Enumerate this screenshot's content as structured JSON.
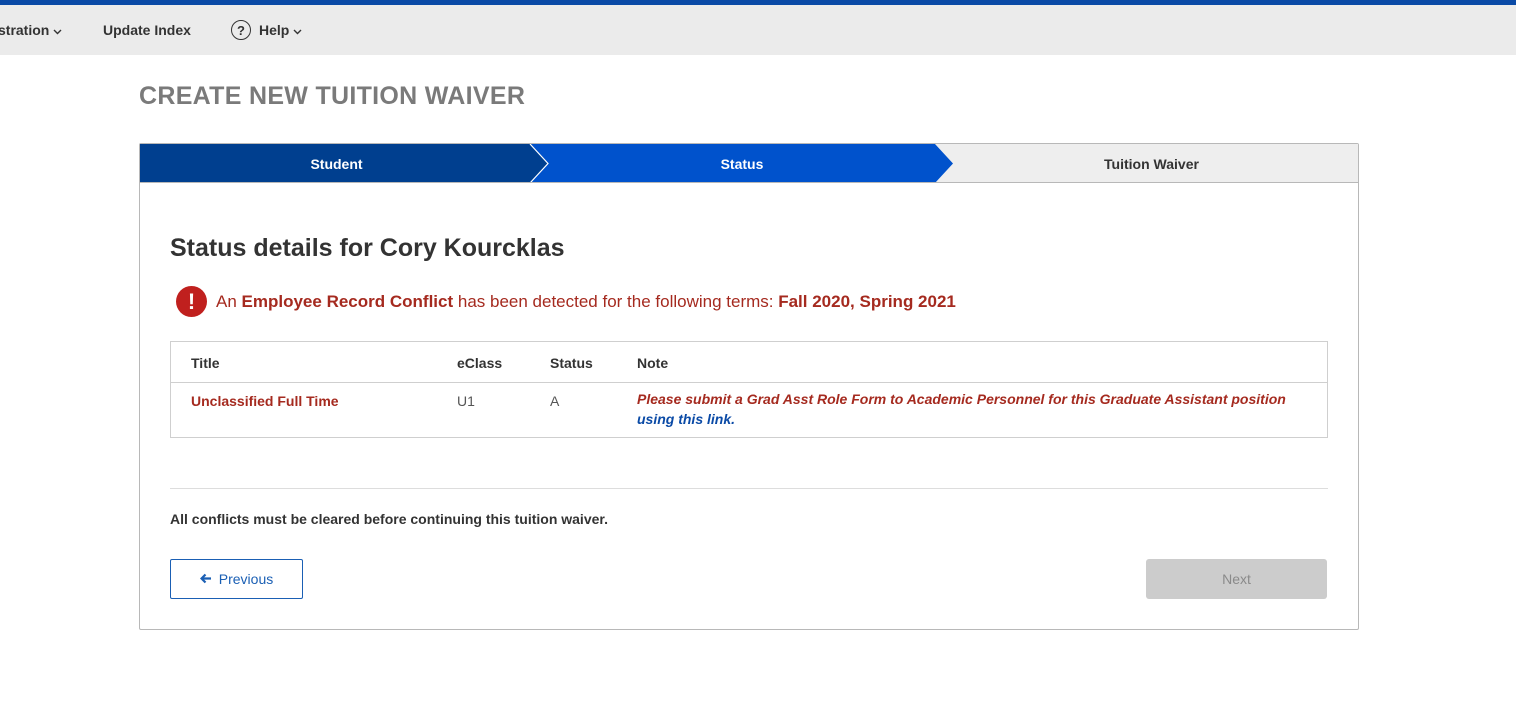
{
  "nav": {
    "admin_label": "stration",
    "update_label": "Update Index",
    "help_label": "Help",
    "help_icon_glyph": "?",
    "chevron_glyph": "⌄"
  },
  "page_title": "CREATE NEW TUITION WAIVER",
  "wizard": {
    "steps": [
      {
        "label": "Student",
        "state": "complete",
        "color": "#003f8f"
      },
      {
        "label": "Status",
        "state": "active",
        "color": "#0052cc"
      },
      {
        "label": "Tuition Waiver",
        "state": "upcoming",
        "color": "#eeeeee"
      }
    ]
  },
  "status": {
    "heading_prefix": "Status details for ",
    "student_name": "Cory Kourcklas"
  },
  "alert": {
    "icon_glyph": "!",
    "text_1": "An ",
    "conflict_type": "Employee Record Conflict",
    "text_2": " has been detected for the following terms: ",
    "terms": "Fall 2020, Spring 2021",
    "color": "#a52a1f"
  },
  "table": {
    "headers": {
      "title": "Title",
      "eclass": "eClass",
      "status": "Status",
      "note": "Note"
    },
    "rows": [
      {
        "title": "Unclassified Full Time",
        "eclass": "U1",
        "status": "A",
        "note_text": "Please submit a Grad Asst Role Form to Academic Personnel for this Graduate Assistant position ",
        "note_link": "using this link",
        "note_end": "."
      }
    ]
  },
  "conflict_message": "All conflicts must be cleared before continuing this tuition waiver.",
  "buttons": {
    "previous_label": "Previous",
    "previous_icon_glyph": "🡐",
    "next_label": "Next"
  }
}
